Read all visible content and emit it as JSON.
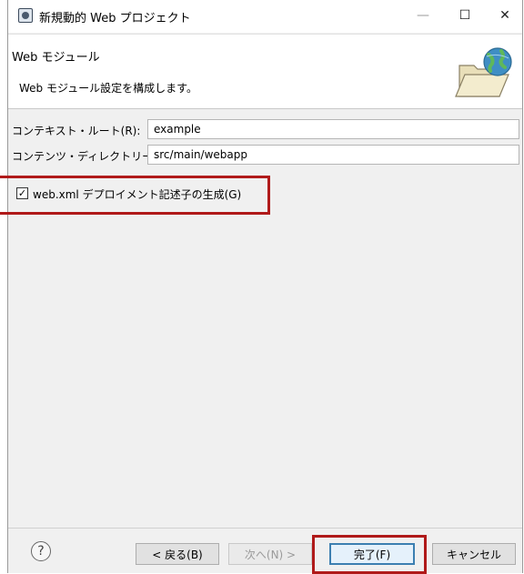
{
  "window": {
    "title": "新規動的 Web プロジェクト",
    "minimize_glyph": "—",
    "maximize_glyph": "☐",
    "close_glyph": "✕"
  },
  "banner": {
    "title": "Web モジュール",
    "description": "Web モジュール設定を構成します。",
    "image_icon": "folder-globe-icon"
  },
  "form": {
    "context_root": {
      "label": "コンテキスト・ルート(R):",
      "value": "example"
    },
    "content_dir": {
      "label": "コンテンツ・ディレクトリー(D):",
      "value": "src/main/webapp"
    },
    "generate_web_xml": {
      "label": "web.xml デプロイメント記述子の生成(G)",
      "checked": true,
      "check_glyph": "✓"
    }
  },
  "footer": {
    "help_glyph": "?",
    "back_label": "< 戻る(B)",
    "next_label": "次へ(N) >",
    "finish_label": "完了(F)",
    "cancel_label": "キャンセル"
  },
  "colors": {
    "highlight": "#b01a1a",
    "primary_border": "#3c7fb1"
  }
}
